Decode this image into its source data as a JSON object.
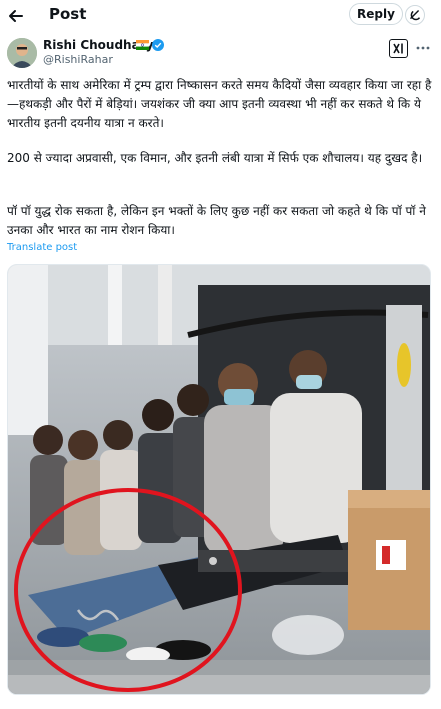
{
  "header": {
    "title": "Post",
    "reply_label": "Reply"
  },
  "author": {
    "name": "Rishi Choudhary",
    "handle": "@RishiRahar"
  },
  "post": {
    "paragraph1": "भारतीयों के साथ अमेरिका में ट्रम्प द्वारा निष्कासन करते समय कैदियों जैसा व्यवहार किया जा रहा है—हथकड़ी और पैरों में बेड़ियां। जयशंकर जी क्या आप इतनी व्यवस्था भी नहीं कर सकते थे कि ये भारतीय इतनी दयनीय यात्रा न करते।",
    "paragraph2": "200 से ज्यादा अप्रवासी, एक विमान, और इतनी लंबी यात्रा में सिर्फ एक शौचालय। यह दुखद है।",
    "paragraph3": "पॉ पॉ युद्ध रोक सकता है, लेकिन इन भक्तों के लिए कुछ नहीं कर सकता जो कहते थे कि पॉ पॉ ने उनका और भारत का नाम रोशन किया।",
    "translate_label": "Translate post"
  },
  "icons": {
    "back": "arrow-left-icon",
    "grok": "grok-icon",
    "verified": "verified-badge-icon",
    "flag": "india-flag-icon",
    "xai": "xai-logo-icon",
    "more": "more-icon"
  },
  "colors": {
    "link": "#1d9bf0",
    "verified": "#1d9bf0",
    "highlight_circle": "#e0141e"
  }
}
